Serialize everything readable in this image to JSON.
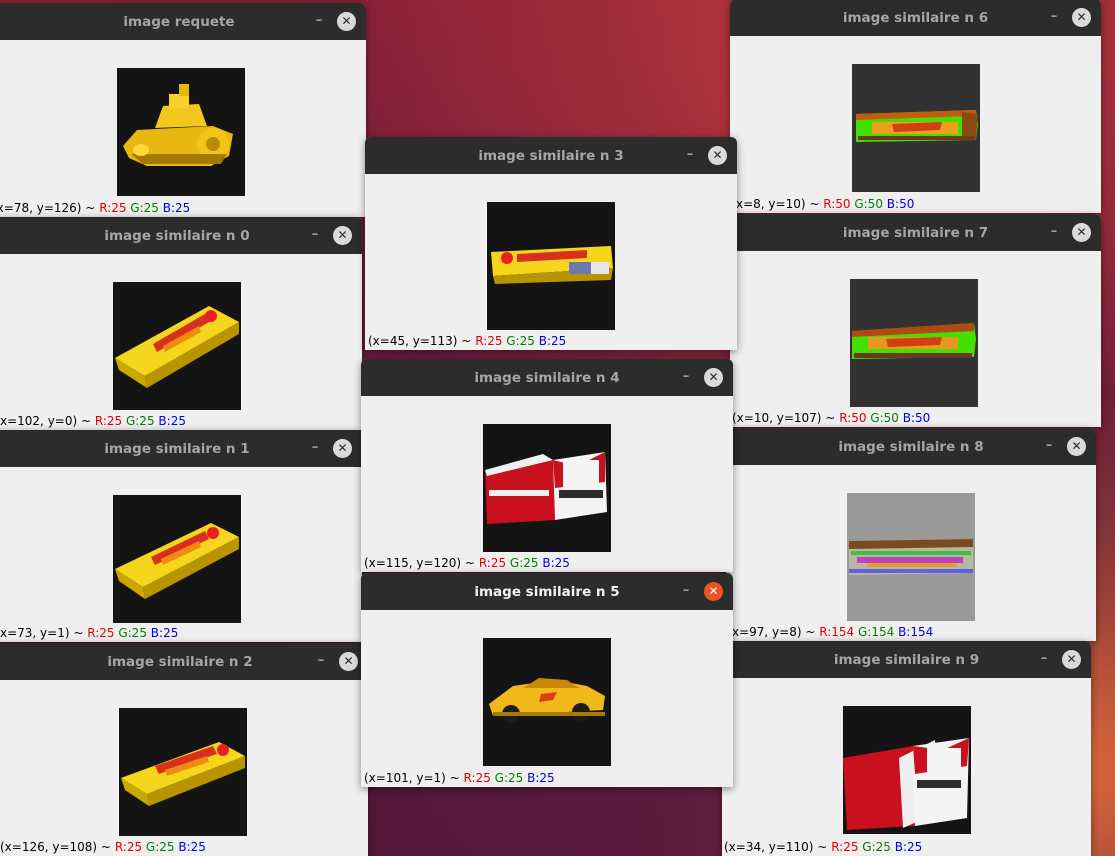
{
  "windows": {
    "requete": {
      "title": "image requete",
      "status_xy": "(x=78, y=126) ~",
      "r": "R:25",
      "g": "G:25",
      "b": "B:25"
    },
    "n0": {
      "title": "image similaire n 0",
      "status_xy": "x=102, y=0) ~",
      "r": "R:25",
      "g": "G:25",
      "b": "B:25"
    },
    "n1": {
      "title": "image similaire n 1",
      "status_xy": "x=73, y=1) ~",
      "r": "R:25",
      "g": "G:25",
      "b": "B:25"
    },
    "n2": {
      "title": "image similaire n 2",
      "status_xy": "(x=126, y=108) ~",
      "r": "R:25",
      "g": "G:25",
      "b": "B:25"
    },
    "n3": {
      "title": "image similaire n 3",
      "status_xy": "(x=45, y=113) ~",
      "r": "R:25",
      "g": "G:25",
      "b": "B:25"
    },
    "n4": {
      "title": "image similaire n 4",
      "status_xy": "(x=115, y=120) ~",
      "r": "R:25",
      "g": "G:25",
      "b": "B:25"
    },
    "n5": {
      "title": "image similaire n 5",
      "status_xy": "(x=101, y=1) ~",
      "r": "R:25",
      "g": "G:25",
      "b": "B:25"
    },
    "n6": {
      "title": "image similaire n 6",
      "status_xy": "x=8, y=10) ~",
      "r": "R:50",
      "g": "G:50",
      "b": "B:50"
    },
    "n7": {
      "title": "image similaire n 7",
      "status_xy": "(x=10, y=107) ~",
      "r": "R:50",
      "g": "G:50",
      "b": "B:50"
    },
    "n8": {
      "title": "image similaire n 8",
      "status_xy": "x=97, y=8) ~",
      "r": "R:154",
      "g": "G:154",
      "b": "B:154"
    },
    "n9": {
      "title": "image similaire n 9",
      "status_xy": "(x=34, y=110) ~",
      "r": "R:25",
      "g": "G:25",
      "b": "B:25"
    }
  },
  "controls": {
    "minimize": "–",
    "close": "✕"
  },
  "colors": {
    "titlebar": "#2c2c2c",
    "active_close": "#e95420",
    "window_bg": "#efefef",
    "red_channel": "#e00000",
    "green_channel": "#008000",
    "blue_channel": "#0000e0"
  },
  "images": {
    "requete": "yellow-toy-boat",
    "n0": "juicy-fruit-gum-pack",
    "n1": "juicy-fruit-gum-pack",
    "n2": "juicy-fruit-gum-pack",
    "n3": "juicy-fruit-gum-pack",
    "n4": "marlboro-cigarette-pack",
    "n5": "yellow-toy-car",
    "n6": "juicy-fruit-gum-pack-false-color",
    "n7": "juicy-fruit-gum-pack-false-color",
    "n8": "juicy-fruit-gum-pack-false-color-grey",
    "n9": "marlboro-cigarette-pack"
  }
}
